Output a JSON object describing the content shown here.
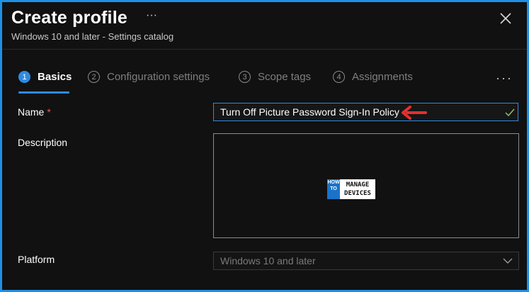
{
  "header": {
    "title": "Create profile",
    "more_label": "···",
    "subtitle": "Windows 10 and later - Settings catalog"
  },
  "steps": [
    {
      "number": "1",
      "label": "Basics",
      "active": true
    },
    {
      "number": "2",
      "label": "Configuration settings",
      "active": false
    },
    {
      "number": "3",
      "label": "Scope tags",
      "active": false
    },
    {
      "number": "4",
      "label": "Assignments",
      "active": false
    }
  ],
  "steps_more_label": "···",
  "form": {
    "name_label": "Name",
    "required_marker": "*",
    "name_value": "Turn Off Picture Password Sign-In Policy",
    "description_label": "Description",
    "description_value": "",
    "platform_label": "Platform",
    "platform_value": "Windows 10 and later"
  },
  "watermark": {
    "left_text": "HOW TO",
    "right_text": "MANAGE DEVICES"
  },
  "colors": {
    "accent": "#2f8be0",
    "frame_border": "#1e90e6",
    "annotation_arrow": "#e53030",
    "required": "#e05a5a"
  }
}
